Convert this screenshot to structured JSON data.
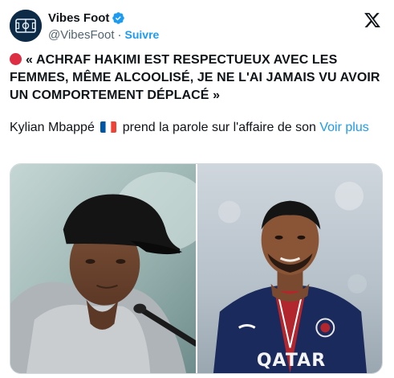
{
  "account": {
    "display_name": "Vibes Foot",
    "handle": "@VibesFoot",
    "separator": "·",
    "follow_label": "Suivre",
    "avatar_icon": "vibes-foot-logo",
    "verified_icon": "verified-badge-icon",
    "platform_icon": "x-logo-icon"
  },
  "tweet": {
    "headline_emoji": "red-circle-icon",
    "headline": "« ACHRAF HAKIMI EST RESPECTUEUX AVEC LES FEMMES, MÊME ALCOOLISÉ, JE NE L'AI JAMAIS VU AVOIR UN COMPORTEMENT DÉPLACÉ »",
    "body_before_flag": "Kylian Mbappé",
    "flag_icon": "france-flag-icon",
    "body_after_flag": "prend la parole sur l'affaire de son",
    "see_more_label": "Voir plus"
  },
  "media": {
    "left_photo": "mbappe-press-conference-photo",
    "right_photo": "hakimi-psg-jersey-photo",
    "jersey_sponsor_text": "QATAR"
  },
  "colors": {
    "accent": "#1d9bf0",
    "text": "#0f1419",
    "secondary": "#536471",
    "alert_red": "#dd2e44"
  }
}
